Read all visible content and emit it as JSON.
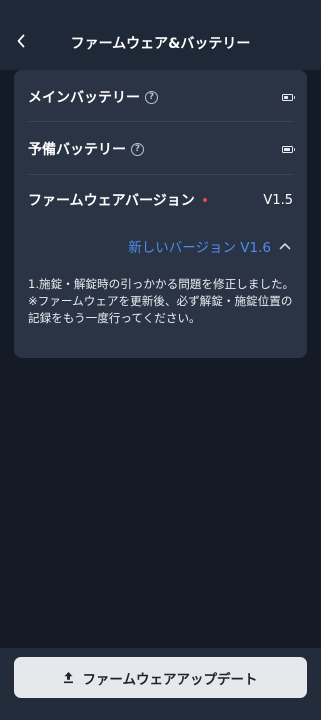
{
  "header": {
    "title": "ファームウェア&バッテリー"
  },
  "rows": {
    "main_battery": {
      "label": "メインバッテリー",
      "help": "?",
      "battery_level": 0.6
    },
    "spare_battery": {
      "label": "予備バッテリー",
      "help": "?",
      "battery_level": 0.9
    },
    "firmware": {
      "label": "ファームウェアバージョン",
      "value": "V1.5"
    }
  },
  "new_version": {
    "label": "新しいバージョン V1.6"
  },
  "release_notes": "1.施錠・解錠時の引っかかる問題を修正しました。\n※ファームウェアを更新後、必ず解錠・施錠位置の記録をもう一度行ってください。",
  "footer": {
    "update_button_label": "ファームウェアアップデート"
  },
  "colors": {
    "accent": "#4d8df0",
    "alert_dot": "#e5484d",
    "background": "#141b27",
    "card": "#2a3444"
  }
}
